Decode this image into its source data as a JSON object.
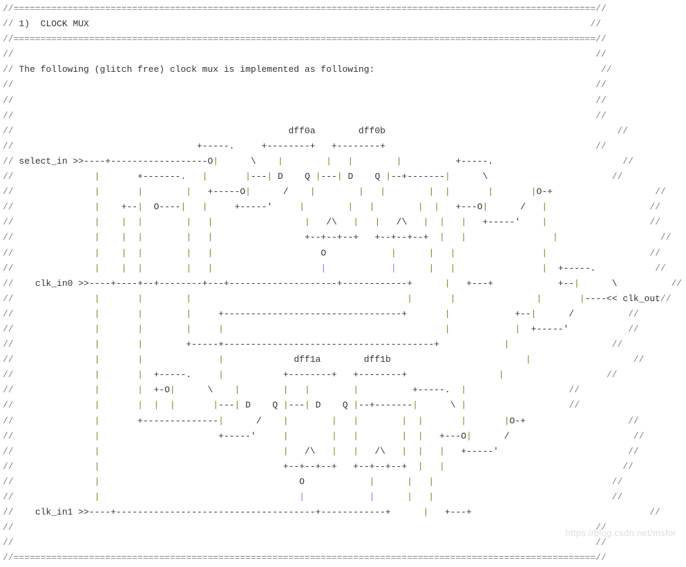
{
  "section": {
    "number": "1)",
    "title": "CLOCK MUX"
  },
  "description": "The following (glitch free) clock mux is implemented as following:",
  "signals": {
    "select_in": "select_in",
    "clk_in0": "clk_in0",
    "clk_in1": "clk_in1",
    "clk_out": "clk_out"
  },
  "blocks": {
    "dff0a": "dff0a",
    "dff0b": "dff0b",
    "dff1a": "dff1a",
    "dff1b": "dff1b"
  },
  "ascii_tokens": {
    "D": "D",
    "Q": "Q",
    "O": "O",
    "arrow_in": ">>",
    "arrow_out": "<<"
  },
  "watermark": "https://blog.csdn.net/msfor"
}
